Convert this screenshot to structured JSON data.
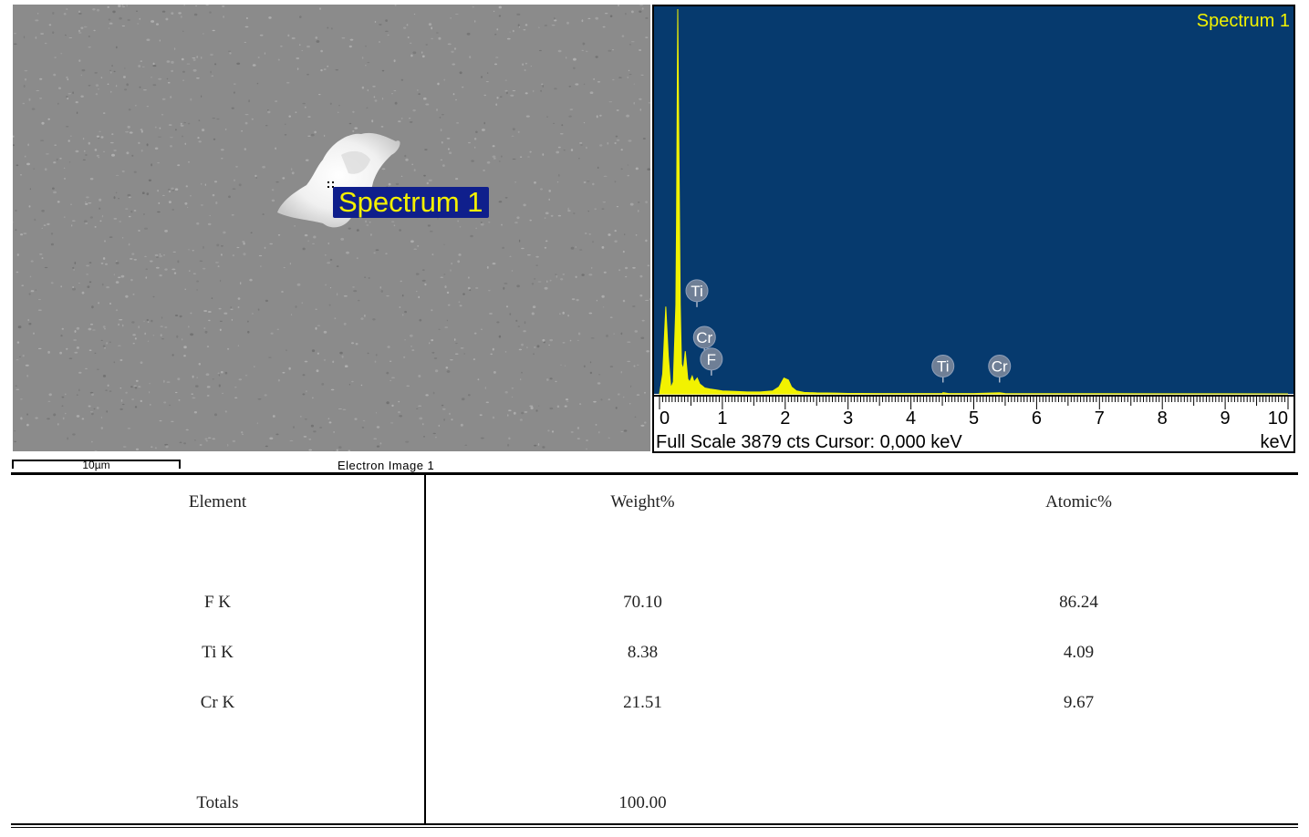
{
  "electron_image": {
    "caption": "Electron Image 1",
    "scale_bar": "10µm",
    "spectrum_label": "Spectrum 1"
  },
  "spectrum_panel": {
    "title": "Spectrum 1",
    "footer_left": "Full Scale 3879 cts  Cursor: 0,000 keV",
    "footer_right": "keV",
    "colors": {
      "background": "#063a6e",
      "trace": "#f2f200",
      "text": "#f2f200",
      "peak_label": "#6f7f96"
    }
  },
  "chart_data": {
    "type": "line",
    "title": "Spectrum 1",
    "xlabel": "keV",
    "ylabel": "",
    "xlim": [
      0,
      10
    ],
    "ylim": [
      0,
      3879
    ],
    "x_ticks": [
      "0",
      "1",
      "2",
      "3",
      "4",
      "5",
      "6",
      "7",
      "8",
      "9",
      "10"
    ],
    "series": [
      {
        "x": [
          0.0,
          0.05,
          0.1,
          0.14,
          0.18,
          0.22,
          0.26,
          0.27,
          0.29,
          0.31,
          0.33,
          0.35,
          0.38,
          0.41,
          0.45,
          0.48,
          0.52,
          0.55,
          0.6,
          0.64,
          0.68,
          0.72,
          0.8,
          0.9,
          1.0,
          1.2,
          1.4,
          1.6,
          1.8,
          1.9,
          1.98,
          2.05,
          2.1,
          2.18,
          2.3,
          2.5,
          2.8,
          3.0,
          3.2,
          3.5,
          4.0,
          4.5,
          4.51,
          4.6,
          5.0,
          5.41,
          5.5,
          6.0,
          7.0,
          8.0,
          9.0,
          10.0
        ],
        "y": [
          0,
          200,
          880,
          380,
          60,
          120,
          900,
          1700,
          3879,
          2400,
          900,
          300,
          250,
          430,
          150,
          120,
          180,
          120,
          160,
          100,
          80,
          60,
          50,
          40,
          30,
          25,
          20,
          20,
          30,
          70,
          160,
          140,
          70,
          30,
          15,
          10,
          8,
          5,
          4,
          3,
          3,
          3,
          12,
          3,
          3,
          12,
          3,
          2,
          2,
          1,
          1,
          0
        ]
      }
    ],
    "peak_labels": [
      {
        "label": "Ti",
        "x": 0.45,
        "y": 930
      },
      {
        "label": "Cr",
        "x": 0.57,
        "y": 460
      },
      {
        "label": "F",
        "x": 0.68,
        "y": 240
      },
      {
        "label": "Ti",
        "x": 4.51,
        "y": 170
      },
      {
        "label": "Cr",
        "x": 5.41,
        "y": 170
      }
    ]
  },
  "table": {
    "headers": [
      "Element",
      "Weight%",
      "Atomic%"
    ],
    "rows": [
      [
        "F K",
        "70.10",
        "86.24"
      ],
      [
        "Ti K",
        "8.38",
        "4.09"
      ],
      [
        "Cr K",
        "21.51",
        "9.67"
      ]
    ],
    "totals": [
      "Totals",
      "100.00",
      ""
    ]
  }
}
